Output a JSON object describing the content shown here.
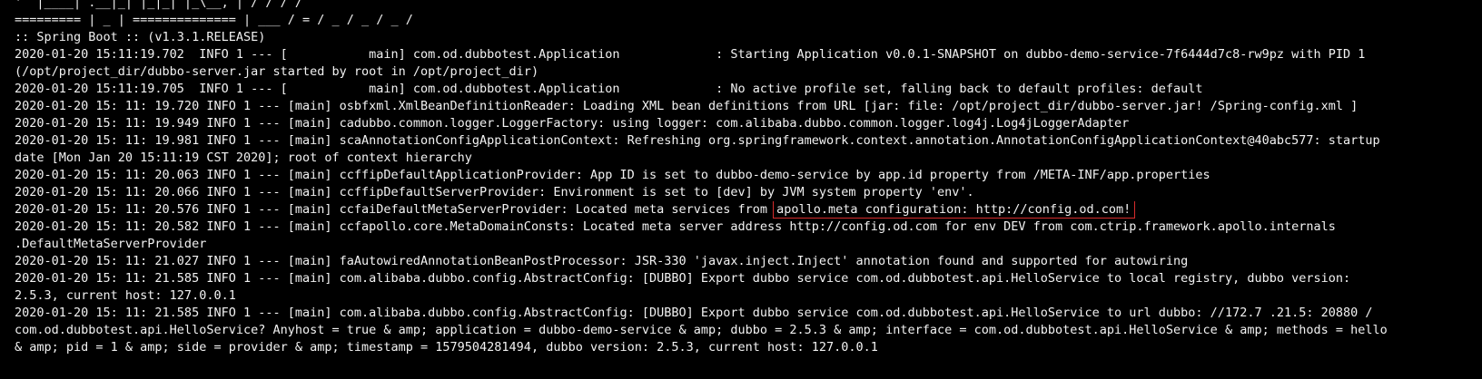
{
  "terminal": {
    "banner": {
      "line1": "'  |____| .__|_| |_|_| |_\\__, | / / / /",
      "line2": "========= | _ | ============== | ___ / = / _ / _ / _ /",
      "version": ":: Spring Boot :: (v1.3.1.RELEASE)"
    },
    "log": {
      "l01": "2020-01-20 15:11:19.702  INFO 1 --- [           main] com.od.dubbotest.Application             : Starting Application v0.0.1-SNAPSHOT on dubbo-demo-service-7f6444d7c8-rw9pz with PID 1",
      "l02": "(/opt/project_dir/dubbo-server.jar started by root in /opt/project_dir)",
      "l03": "2020-01-20 15:11:19.705  INFO 1 --- [           main] com.od.dubbotest.Application             : No active profile set, falling back to default profiles: default",
      "l04": "2020-01-20 15: 11: 19.720 INFO 1 --- [main] osbfxml.XmlBeanDefinitionReader: Loading XML bean definitions from URL [jar: file: /opt/project_dir/dubbo-server.jar! /Spring-config.xml ]",
      "l05": "2020-01-20 15: 11: 19.949 INFO 1 --- [main] cadubbo.common.logger.LoggerFactory: using logger: com.alibaba.dubbo.common.logger.log4j.Log4jLoggerAdapter",
      "l06": "2020-01-20 15: 11: 19.981 INFO 1 --- [main] scaAnnotationConfigApplicationContext: Refreshing org.springframework.context.annotation.AnnotationConfigApplicationContext@40abc577: startup",
      "l07": "date [Mon Jan 20 15:11:19 CST 2020]; root of context hierarchy",
      "l08": "2020-01-20 15: 11: 20.063 INFO 1 --- [main] ccffipDefaultApplicationProvider: App ID is set to dubbo-demo-service by app.id property from /META-INF/app.properties",
      "l09": "2020-01-20 15: 11: 20.066 INFO 1 --- [main] ccffipDefaultServerProvider: Environment is set to [dev] by JVM system property 'env'.",
      "l10_prefix": "2020-01-20 15: 11: 20.576 INFO 1 --- [main] ccfaiDefaultMetaServerProvider: Located meta services from ",
      "l10_highlight": "apollo.meta configuration: http://config.od.com!",
      "l11": "2020-01-20 15: 11: 20.582 INFO 1 --- [main] ccfapollo.core.MetaDomainConsts: Located meta server address http://config.od.com for env DEV from com.ctrip.framework.apollo.internals",
      "l12": ".DefaultMetaServerProvider",
      "l13": "2020-01-20 15: 11: 21.027 INFO 1 --- [main] faAutowiredAnnotationBeanPostProcessor: JSR-330 'javax.inject.Inject' annotation found and supported for autowiring",
      "l14": "2020-01-20 15: 11: 21.585 INFO 1 --- [main] com.alibaba.dubbo.config.AbstractConfig: [DUBBO] Export dubbo service com.od.dubbotest.api.HelloService to local registry, dubbo version:",
      "l15": "2.5.3, current host: 127.0.0.1",
      "l16": "2020-01-20 15: 11: 21.585 INFO 1 --- [main] com.alibaba.dubbo.config.AbstractConfig: [DUBBO] Export dubbo service com.od.dubbotest.api.HelloService to url dubbo: //172.7 .21.5: 20880 /",
      "l17": "com.od.dubbotest.api.HelloService? Anyhost = true & amp; application = dubbo-demo-service & amp; dubbo = 2.5.3 & amp; interface = com.od.dubbotest.api.HelloService & amp; methods = hello",
      "l18": "& amp; pid = 1 & amp; side = provider & amp; timestamp = 1579504281494, dubbo version: 2.5.3, current host: 127.0.0.1"
    },
    "colors": {
      "background": "#000000",
      "text": "#f2f2f2",
      "highlight_box": "#d62b2b"
    }
  }
}
